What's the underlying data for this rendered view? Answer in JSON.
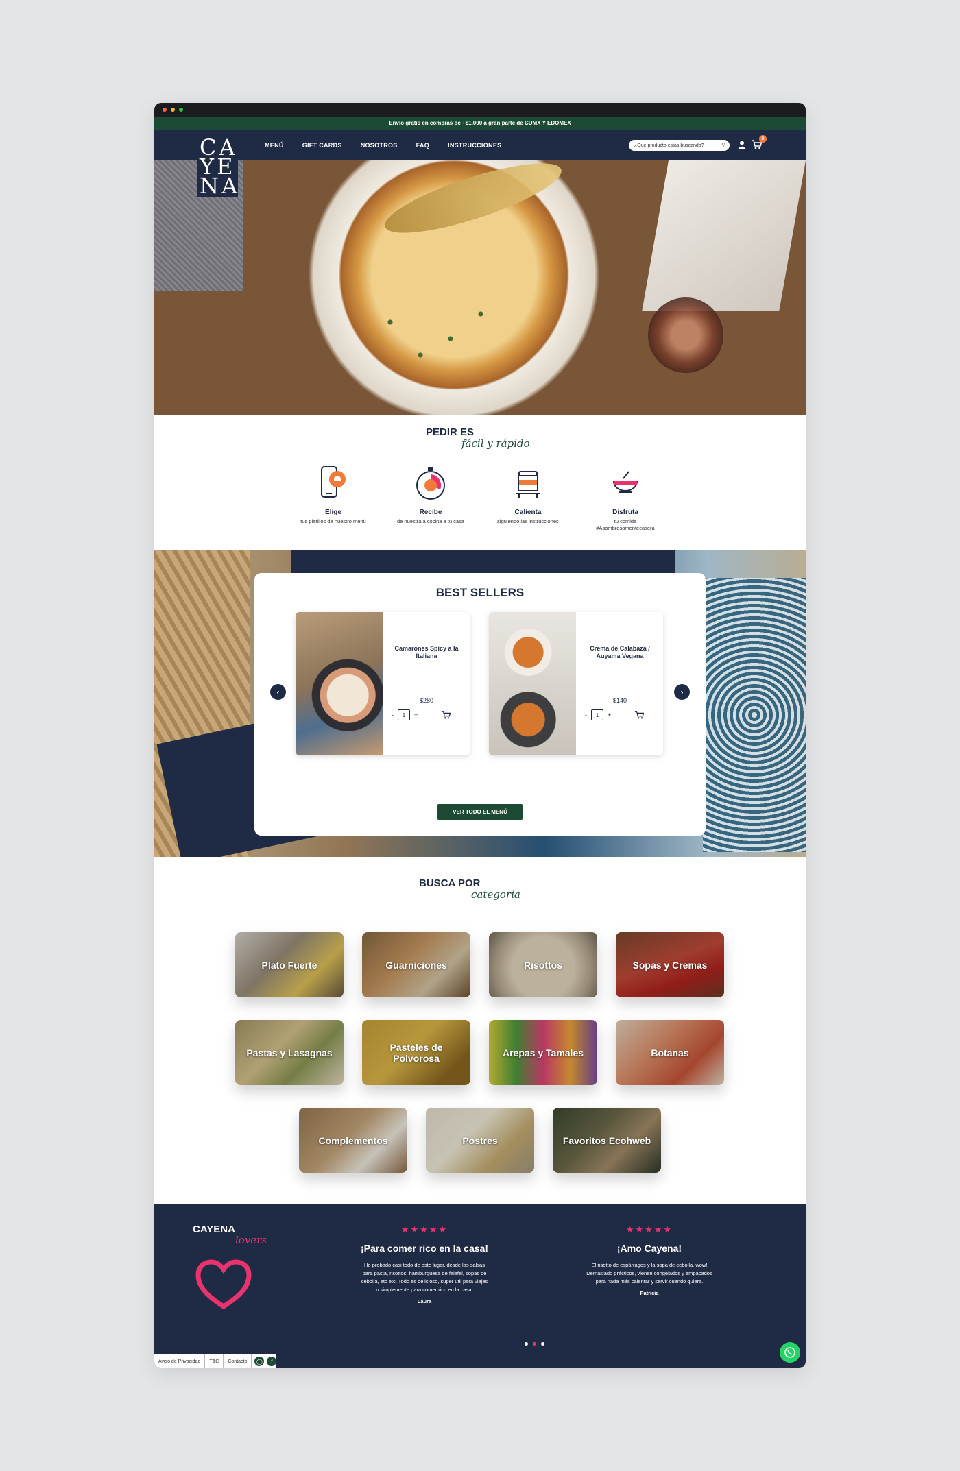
{
  "announcement": "Envío gratis en compras de +$1,000 a gran parte de CDMX Y EDOMEX",
  "brand": {
    "logo_lines": [
      "CA",
      "YE",
      "NA"
    ]
  },
  "nav": {
    "items": [
      "MENÚ",
      "GIFT CARDS",
      "NOSOTROS",
      "FAQ",
      "INSTRUCCIONES"
    ]
  },
  "search": {
    "placeholder": "¿Qué producto estás buscando?"
  },
  "cart": {
    "count": "0"
  },
  "order_section": {
    "title": "PEDIR ES",
    "script": "fácil y rápido",
    "steps": [
      {
        "title": "Elige",
        "desc": "tus platillos de nuestro menú",
        "icon": "phone-icon"
      },
      {
        "title": "Recibe",
        "desc": "de nuestra a cocina a tu casa",
        "icon": "stopwatch-icon"
      },
      {
        "title": "Calienta",
        "desc": "siguiendo las instrucciones",
        "icon": "pot-icon"
      },
      {
        "title": "Disfruta",
        "desc": "tu comida #Asombrosamentecasera",
        "icon": "bowl-icon"
      }
    ]
  },
  "best_sellers": {
    "title": "BEST SELLERS",
    "products": [
      {
        "name": "Camarones Spicy a la Italiana",
        "price": "$280",
        "qty": "1"
      },
      {
        "name": "Crema de Calabaza / Auyama Vegana",
        "price": "$140",
        "qty": "1"
      }
    ],
    "button": "VER TODO EL MENÚ"
  },
  "categories": {
    "title": "BUSCA POR",
    "script": "categoría",
    "items": [
      "Plato Fuerte",
      "Guarniciones",
      "Risottos",
      "Sopas y Cremas",
      "Pastas y Lasagnas",
      "Pasteles de Polvorosa",
      "Arepas y Tamales",
      "Botanas",
      "Complementos",
      "Postres",
      "Favoritos Ecohweb"
    ]
  },
  "lovers": {
    "title": "CAYENA",
    "script": "lovers",
    "reviews": [
      {
        "stars": "★★★★★",
        "title": "¡Para comer rico en la casa!",
        "body": "He probado casi todo de este lugar, desde las salsas para pasta, risottos, hamburguesa de falafel, sopas de cebolla, etc etc. Todo es delicioso, super util para viajes o simplemente para comer rico en la casa.",
        "author": "Laura"
      },
      {
        "stars": "★★★★★",
        "title": "¡Amo Cayena!",
        "body": "El risotto de espárragos y la sopa de cebolla, wow! Demasiado prácticos, vienen congelados y empacados para nada más calentar y servir cuando quiera.",
        "author": "Patricia"
      }
    ]
  },
  "footer": {
    "links": [
      "Aviso de Privacidad",
      "T&C",
      "Contacto"
    ]
  },
  "colors": {
    "navy": "#1f2a44",
    "green": "#1d4a35",
    "pink": "#e8336e",
    "orange": "#f07a3a"
  }
}
